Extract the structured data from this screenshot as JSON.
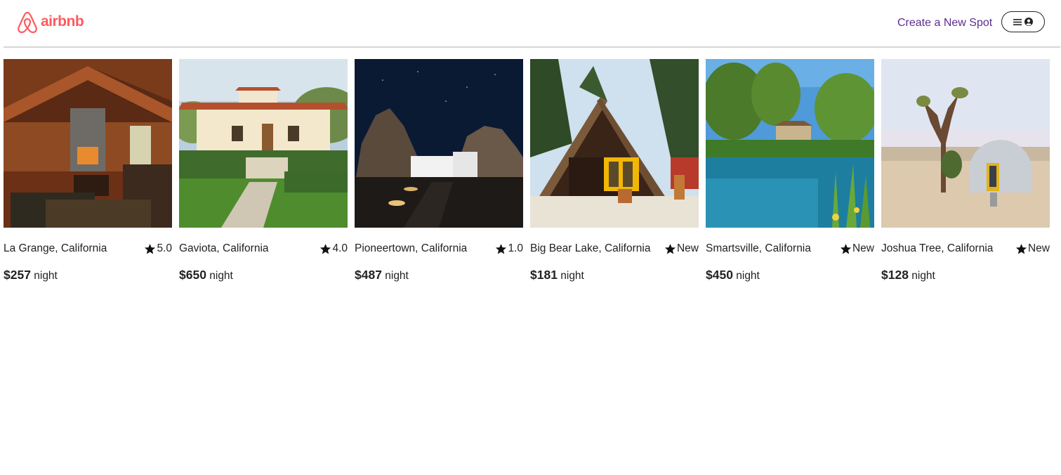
{
  "header": {
    "logo_text": "airbnb",
    "create_spot_label": "Create a New Spot",
    "menu_icon": "hamburger-icon",
    "profile_icon": "user-circle-icon",
    "brand_color": "#ff5a5f",
    "link_color": "#5b2d8e"
  },
  "spots": [
    {
      "location": "La Grange, California",
      "rating": "5.0",
      "price": "$257",
      "unit": "night",
      "image": "cabin-interior"
    },
    {
      "location": "Gaviota, California",
      "rating": "4.0",
      "price": "$650",
      "unit": "night",
      "image": "spanish-villa"
    },
    {
      "location": "Pioneertown, California",
      "rating": "1.0",
      "price": "$487",
      "unit": "night",
      "image": "desert-night-house"
    },
    {
      "location": "Big Bear Lake, California",
      "rating": "New",
      "price": "$181",
      "unit": "night",
      "image": "a-frame-cabin"
    },
    {
      "location": "Smartsville, California",
      "rating": "New",
      "price": "$450",
      "unit": "night",
      "image": "lake-house"
    },
    {
      "location": "Joshua Tree, California",
      "rating": "New",
      "price": "$128",
      "unit": "night",
      "image": "desert-dome"
    }
  ]
}
